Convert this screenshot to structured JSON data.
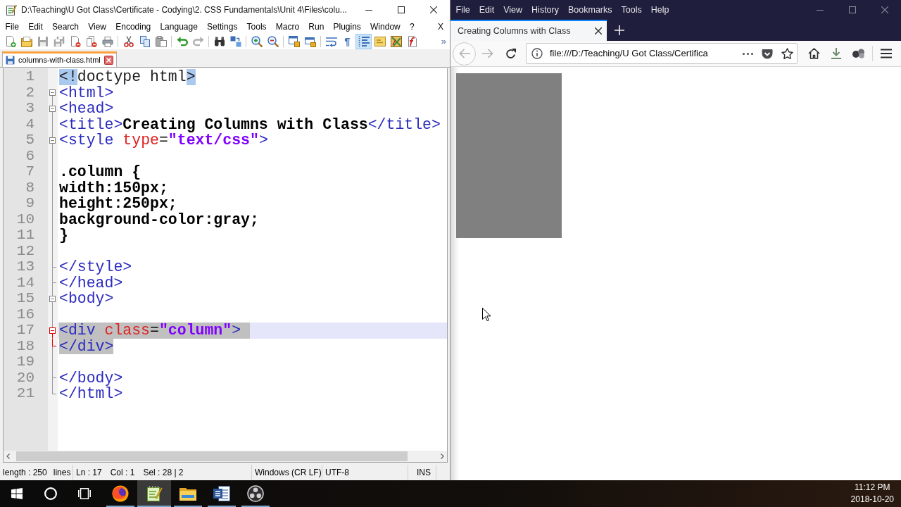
{
  "notepad": {
    "title": "D:\\Teaching\\U Got Class\\Certificate - Codying\\2. CSS Fundamentals\\Unit 4\\Files\\colu...",
    "menu": [
      "File",
      "Edit",
      "Search",
      "View",
      "Encoding",
      "Language",
      "Settings",
      "Tools",
      "Macro",
      "Run",
      "Plugins",
      "Window",
      "?"
    ],
    "menu_close": "X",
    "toolbar": [
      [
        {
          "kind": "new",
          "disabled": false,
          "pressed": false
        },
        {
          "kind": "open",
          "disabled": false,
          "pressed": false
        },
        {
          "kind": "save",
          "disabled": true,
          "pressed": false
        },
        {
          "kind": "save-all",
          "disabled": true,
          "pressed": false
        },
        {
          "kind": "close",
          "disabled": false,
          "pressed": false
        },
        {
          "kind": "close-all",
          "disabled": false,
          "pressed": false
        },
        {
          "kind": "print",
          "disabled": false,
          "pressed": false
        }
      ],
      [
        {
          "kind": "cut",
          "disabled": false,
          "pressed": false
        },
        {
          "kind": "copy",
          "disabled": false,
          "pressed": false
        },
        {
          "kind": "paste",
          "disabled": false,
          "pressed": false
        }
      ],
      [
        {
          "kind": "undo",
          "disabled": false,
          "pressed": false
        },
        {
          "kind": "redo",
          "disabled": true,
          "pressed": false
        }
      ],
      [
        {
          "kind": "find",
          "disabled": false,
          "pressed": false
        },
        {
          "kind": "replace",
          "disabled": false,
          "pressed": false
        }
      ],
      [
        {
          "kind": "zoom-in",
          "disabled": false,
          "pressed": false
        },
        {
          "kind": "zoom-out",
          "disabled": false,
          "pressed": false
        }
      ],
      [
        {
          "kind": "sync-vertical",
          "disabled": false,
          "pressed": false
        },
        {
          "kind": "sync-horizontal",
          "disabled": false,
          "pressed": false
        }
      ],
      [
        {
          "kind": "wrap",
          "disabled": false,
          "pressed": false
        },
        {
          "kind": "symbols",
          "text": "¶",
          "disabled": false,
          "pressed": false
        },
        {
          "kind": "indent-guide",
          "disabled": false,
          "pressed": true
        },
        {
          "kind": "language",
          "disabled": false,
          "pressed": false
        },
        {
          "kind": "doc-map",
          "disabled": false,
          "pressed": false
        },
        {
          "kind": "function-list",
          "disabled": false,
          "pressed": false
        }
      ]
    ],
    "toolbar_overflow": "»",
    "tabs": [
      {
        "label": "columns-with-class.html",
        "selected": true
      }
    ],
    "lines": [
      {
        "number": "1",
        "kind": "no-fold",
        "current": false,
        "selected": false,
        "segments": [
          {
            "kind": "match",
            "text": "<!"
          },
          {
            "kind": "plain",
            "text": "doctype html"
          },
          {
            "kind": "match",
            "text": ">"
          }
        ]
      },
      {
        "number": "2",
        "kind": "fold-head",
        "current": false,
        "selected": false,
        "segments": [
          {
            "kind": "tag",
            "text": "<html>"
          }
        ]
      },
      {
        "number": "3",
        "kind": "fold-open",
        "current": false,
        "selected": false,
        "segments": [
          {
            "kind": "tag",
            "text": "<head>"
          }
        ]
      },
      {
        "number": "4",
        "kind": "fold-body",
        "current": false,
        "selected": false,
        "segments": [
          {
            "kind": "tag",
            "text": "<title>"
          },
          {
            "kind": "content",
            "text": "Creating Columns with Class"
          },
          {
            "kind": "tag",
            "text": "</title>"
          }
        ]
      },
      {
        "number": "5",
        "kind": "fold-open",
        "current": false,
        "selected": false,
        "segments": [
          {
            "kind": "tag",
            "text": "<style"
          },
          {
            "kind": "attr",
            "text": " type"
          },
          {
            "kind": "punct",
            "text": "="
          },
          {
            "kind": "value",
            "text": "\"text/css\""
          },
          {
            "kind": "tag",
            "text": ">"
          }
        ]
      },
      {
        "number": "6",
        "kind": "fold-body",
        "current": false,
        "selected": false
      },
      {
        "number": "7",
        "kind": "fold-body",
        "current": false,
        "selected": false,
        "segments": [
          {
            "kind": "content",
            "text": ".column {"
          }
        ]
      },
      {
        "number": "8",
        "kind": "fold-body",
        "current": false,
        "selected": false,
        "segments": [
          {
            "kind": "content",
            "text": "width:150px;"
          }
        ]
      },
      {
        "number": "9",
        "kind": "fold-body",
        "current": false,
        "selected": false,
        "segments": [
          {
            "kind": "content",
            "text": "height:250px;"
          }
        ]
      },
      {
        "number": "10",
        "kind": "fold-body",
        "current": false,
        "selected": false,
        "segments": [
          {
            "kind": "content",
            "text": "background-color:gray;"
          }
        ]
      },
      {
        "number": "11",
        "kind": "fold-body",
        "current": false,
        "selected": false,
        "segments": [
          {
            "kind": "content",
            "text": "}"
          }
        ]
      },
      {
        "number": "12",
        "kind": "fold-body",
        "current": false,
        "selected": false
      },
      {
        "number": "13",
        "kind": "fold-end",
        "current": false,
        "selected": false,
        "segments": [
          {
            "kind": "tag",
            "text": "</style>"
          }
        ]
      },
      {
        "number": "14",
        "kind": "fold-end",
        "current": false,
        "selected": false,
        "segments": [
          {
            "kind": "tag",
            "text": "</head>"
          }
        ]
      },
      {
        "number": "15",
        "kind": "fold-open",
        "current": false,
        "selected": false,
        "segments": [
          {
            "kind": "tag",
            "text": "<body>"
          }
        ]
      },
      {
        "number": "16",
        "kind": "fold-body",
        "current": false,
        "selected": false
      },
      {
        "number": "17",
        "kind": "fold-open-active",
        "current": true,
        "selected": true,
        "segments": [
          {
            "kind": "tag",
            "text": "<div"
          },
          {
            "kind": "attr",
            "text": " class"
          },
          {
            "kind": "punct",
            "text": "="
          },
          {
            "kind": "value",
            "text": "\"column\""
          },
          {
            "kind": "tag",
            "text": ">"
          }
        ]
      },
      {
        "number": "18",
        "kind": "fold-end-active",
        "current": false,
        "selected": true,
        "segments": [
          {
            "kind": "tag",
            "text": "</div>"
          }
        ]
      },
      {
        "number": "19",
        "kind": "fold-body",
        "current": false,
        "selected": false
      },
      {
        "number": "20",
        "kind": "fold-end",
        "current": false,
        "selected": false,
        "segments": [
          {
            "kind": "tag",
            "text": "</body>"
          }
        ]
      },
      {
        "number": "21",
        "kind": "fold-last",
        "current": false,
        "selected": false,
        "segments": [
          {
            "kind": "tag",
            "text": "</html>"
          }
        ]
      }
    ],
    "status_bar": [
      {
        "texts": [
          "length : 250",
          "lines"
        ]
      },
      {
        "texts": [
          "Ln : 17",
          "Col : 1",
          "Sel : 28 | 2"
        ]
      },
      {
        "texts": [
          "Windows (CR LF)"
        ]
      },
      {
        "texts": [
          "UTF-8"
        ]
      },
      {
        "texts": [
          "INS"
        ]
      }
    ]
  },
  "firefox": {
    "menu": [
      "File",
      "Edit",
      "View",
      "History",
      "Bookmarks",
      "Tools",
      "Help"
    ],
    "tabs": [
      {
        "title": "Creating Columns with Class",
        "selected": true
      }
    ],
    "nav_buttons": [
      {
        "kind": "back",
        "disabled": true
      },
      {
        "kind": "forward",
        "disabled": true
      },
      {
        "kind": "reload",
        "disabled": false
      }
    ],
    "url": "file:///D:/Teaching/U Got Class/Certifica",
    "page": {
      "blocks": [
        {
          "kind": "column"
        }
      ],
      "pointer": true
    }
  },
  "taskbar": {
    "items": [
      {
        "kind": "start",
        "running": false,
        "selected": false
      },
      {
        "kind": "search",
        "running": false,
        "selected": false
      },
      {
        "kind": "task-view",
        "running": false,
        "selected": false
      },
      {
        "kind": "browser",
        "running": true,
        "selected": false
      },
      {
        "kind": "editor",
        "running": true,
        "selected": true
      },
      {
        "kind": "folder",
        "running": true,
        "selected": false
      },
      {
        "kind": "word-processor",
        "running": true,
        "selected": false
      },
      {
        "kind": "recorder",
        "running": true,
        "selected": false
      }
    ],
    "time": "11:12 PM",
    "date": "2018-10-20"
  }
}
